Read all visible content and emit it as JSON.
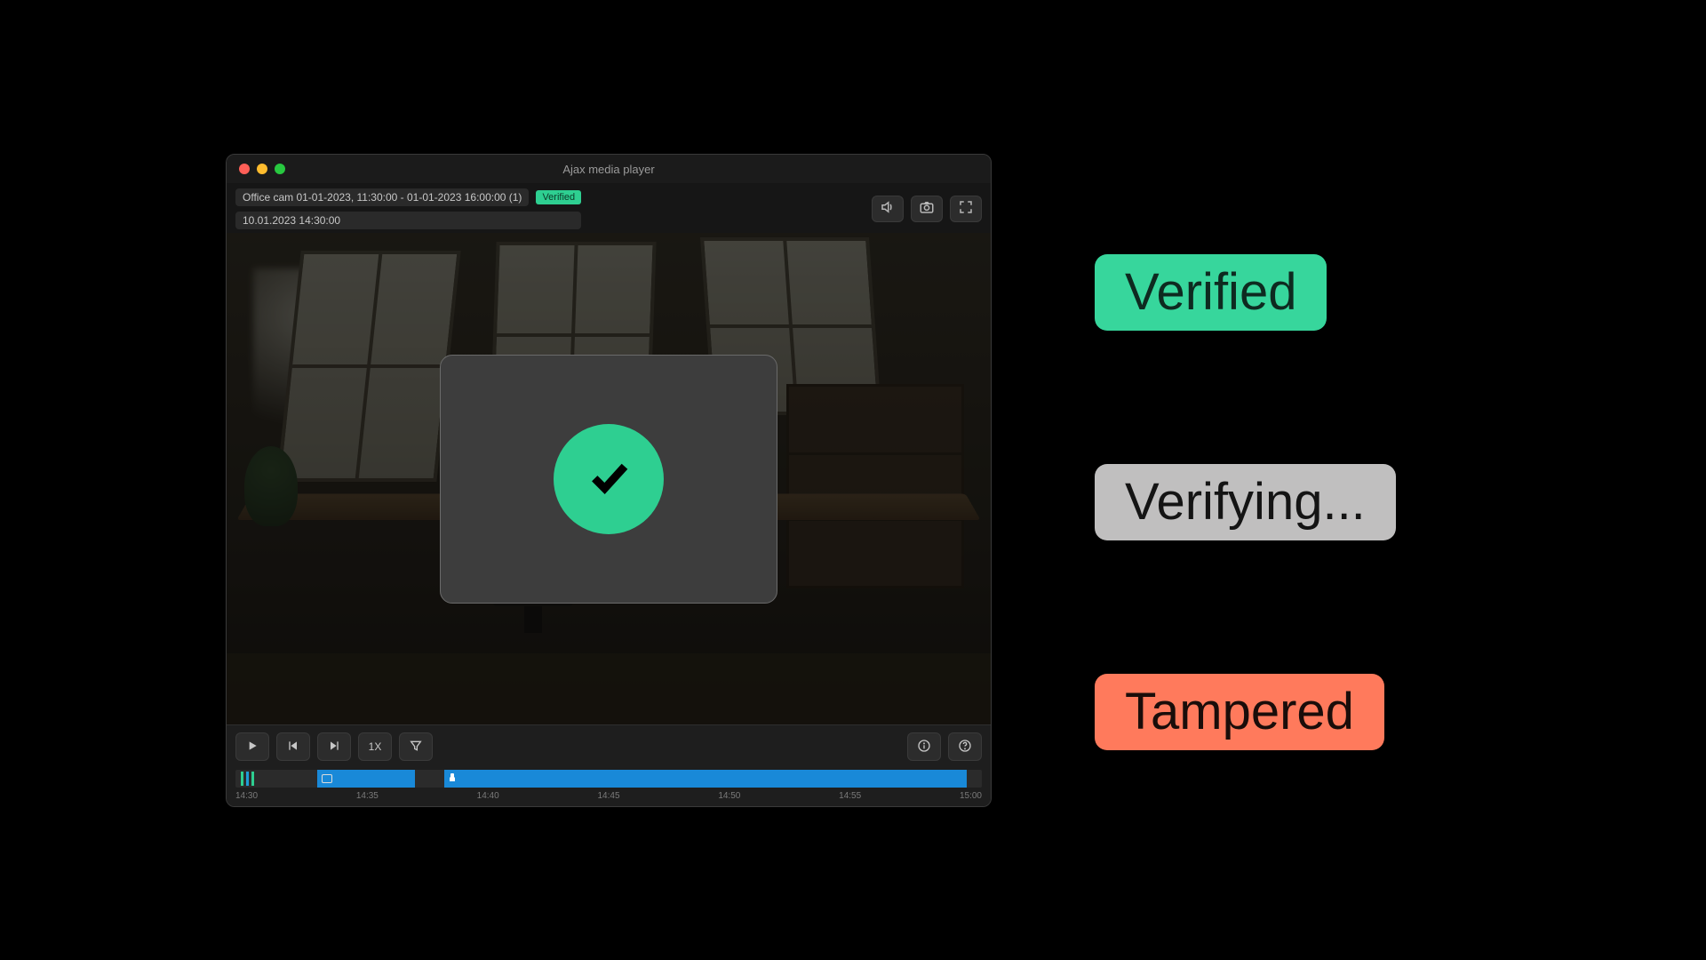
{
  "window": {
    "title": "Ajax media player"
  },
  "tab": {
    "name": "Office cam 01-01-2023, 11:30:00 - 01-01-2023 16:00:00 (1)",
    "badge": "Verified",
    "timestamp": "10.01.2023 14:30:00"
  },
  "playback": {
    "speed_label": "1X"
  },
  "timeline": {
    "ticks": [
      "14:30",
      "14:35",
      "14:40",
      "14:45",
      "14:50",
      "14:55",
      "15:00"
    ]
  },
  "status_pills": {
    "verified_label": "Verified",
    "verifying_label": "Verifying...",
    "tampered_label": "Tampered"
  },
  "colors": {
    "verified": "#37d69c",
    "verifying": "#c0bfbf",
    "tampered": "#ff7a5c",
    "timeline_blue": "#1989d8"
  }
}
